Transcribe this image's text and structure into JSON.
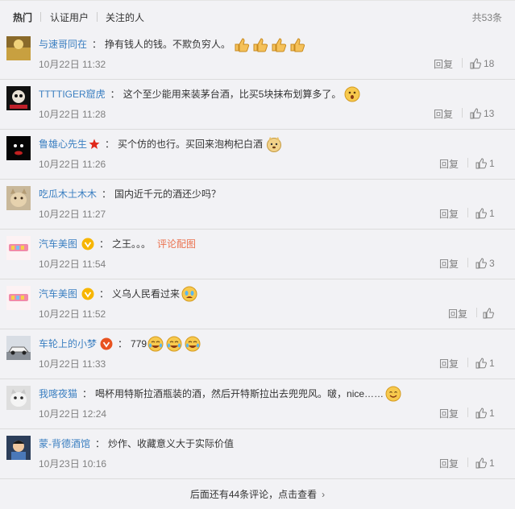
{
  "tabs": [
    {
      "label": "热门"
    },
    {
      "label": "认证用户"
    },
    {
      "label": "关注的人"
    }
  ],
  "total_count": "共53条",
  "comments": [
    {
      "user": "与速哥同在",
      "text": "挣有钱人的钱。不欺负穷人。",
      "emoji": "thumbs-up x4",
      "time": "10月22日 11:32",
      "reply": "回复",
      "likes": "18"
    },
    {
      "user": "TTTTIGER窟虎",
      "text": "这个至少能用来装茅台酒，比买5块抹布划算多了。",
      "emoji": "thinking-face",
      "time": "10月22日 11:28",
      "reply": "回复",
      "likes": "13"
    },
    {
      "user": "鲁雄心先生",
      "text": "买个仿的也行。买回来泡枸杞白酒",
      "emoji": "doge-face",
      "time": "10月22日 11:26",
      "reply": "回复",
      "likes": "1"
    },
    {
      "user": "吃瓜木土木木",
      "text": "国内近千元的酒还少吗？",
      "time": "10月22日 11:27",
      "reply": "回复",
      "likes": "1"
    },
    {
      "user": "汽车美图",
      "text": "之王。。。",
      "link": "评论配图",
      "time": "10月22日 11:54",
      "reply": "回复",
      "likes": "3"
    },
    {
      "user": "汽车美图",
      "text": "义乌人民看过来",
      "emoji": "crying-face",
      "time": "10月22日 11:52",
      "reply": "回复",
      "likes": ""
    },
    {
      "user": "车轮上的小梦",
      "text": "779",
      "emoji": "laughing-tears x3",
      "time": "10月22日 11:33",
      "reply": "回复",
      "likes": "1"
    },
    {
      "user": "我喀夜猫",
      "text": "喝杯用特斯拉酒瓶装的酒，然后开特斯拉出去兜兜风。啵，nice……",
      "emoji": "smile-face",
      "time": "10月22日 12:24",
      "reply": "回复",
      "likes": "1"
    },
    {
      "user": "蒙-背德酒馆",
      "text": "炒作、收藏意义大于实际价值",
      "time": "10月23日 10:16",
      "reply": "回复",
      "likes": "1"
    }
  ],
  "more": {
    "label": "后面还有44条评论，点击查看"
  },
  "colors": {
    "name_link": "#eb7350",
    "meta": "#808080",
    "bg": "#f2f2f5"
  }
}
